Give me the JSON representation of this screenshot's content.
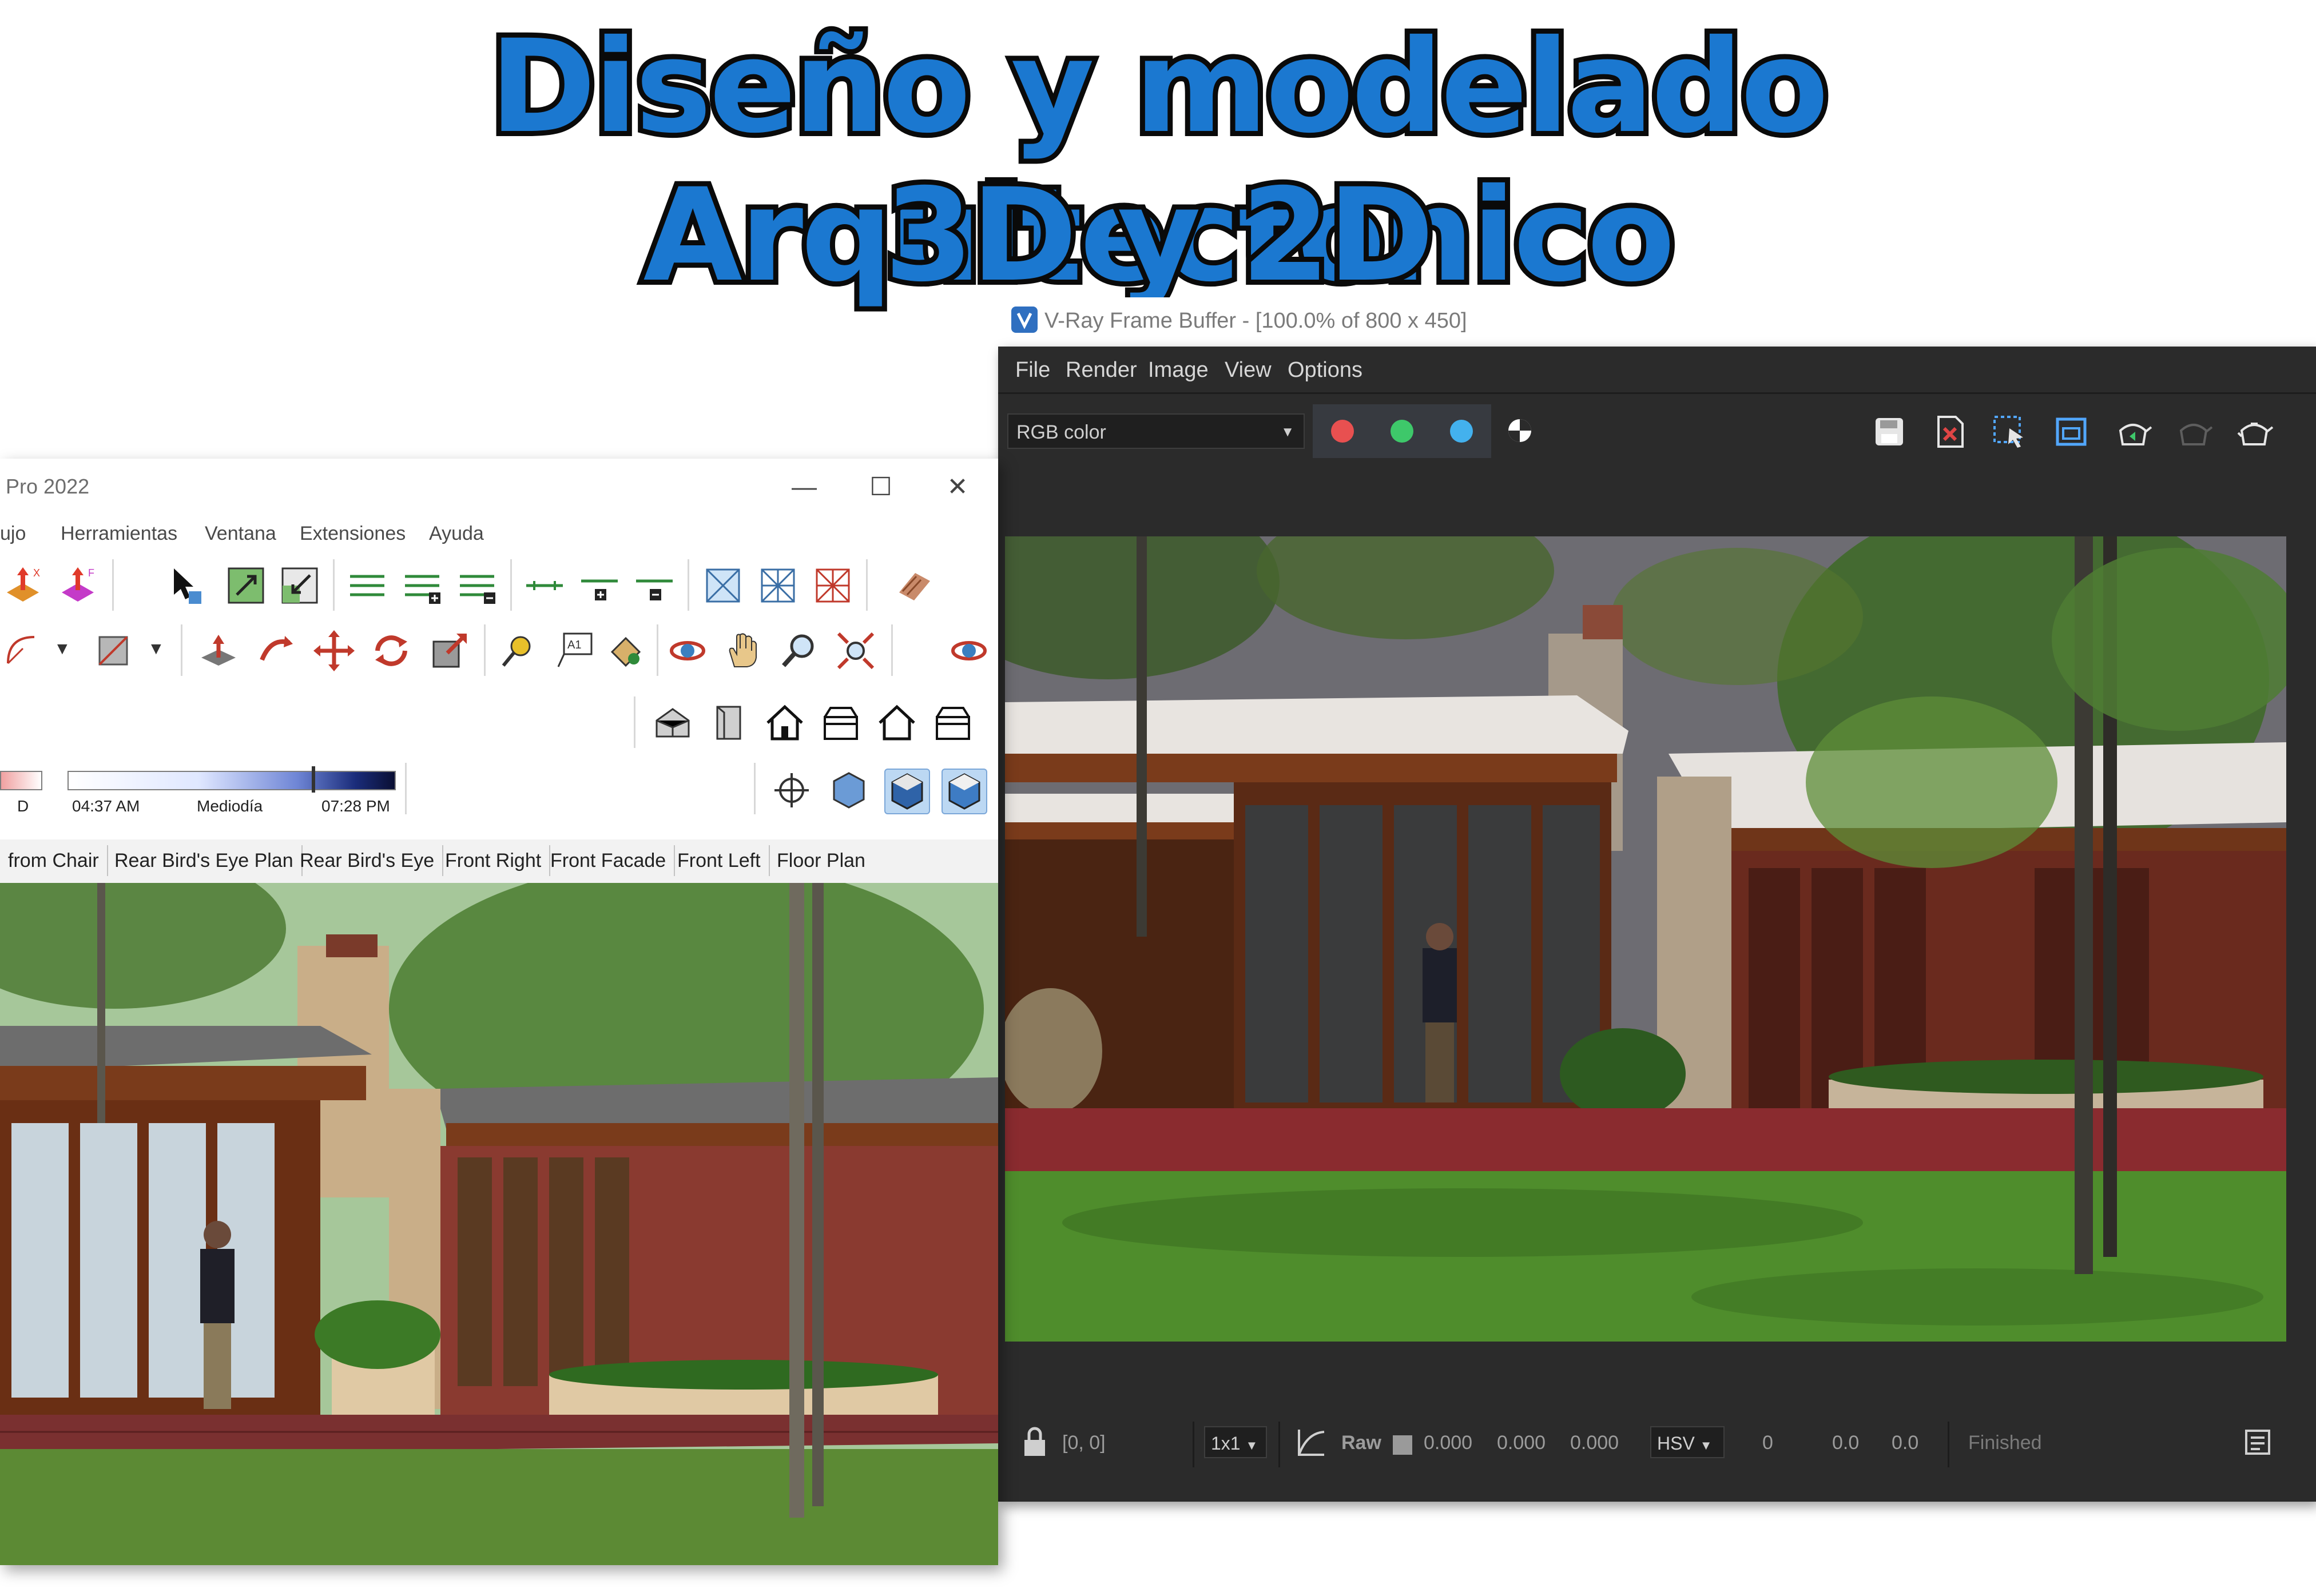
{
  "headline": {
    "line1": "Diseño y modelado Arquitectonico",
    "line2": "3D y 2D"
  },
  "sketchup": {
    "title": "Pro 2022",
    "window_controls": {
      "minimize": "—",
      "maximize": "☐",
      "close": "✕"
    },
    "menu": [
      "ujo",
      "Herramientas",
      "Ventana",
      "Extensiones",
      "Ayuda"
    ],
    "shadow": {
      "left_label": "D",
      "start_time": "04:37 AM",
      "mid_label": "Mediodía",
      "end_time": "07:28 PM"
    },
    "scenes": [
      "from Chair",
      "Rear Bird's Eye Plan",
      "Rear Bird's Eye",
      "Front Right",
      "Front Facade",
      "Front Left",
      "Floor Plan"
    ],
    "icon_text": {
      "text_tool": "A1",
      "axis_x": "X",
      "axis_f": "F"
    }
  },
  "vray": {
    "caption": "V-Ray Frame Buffer - [100.0% of 800 x 450]",
    "menu": [
      "File",
      "Render",
      "Image",
      "View",
      "Options"
    ],
    "channel_select": "RGB color",
    "channel_colors": {
      "red": "#e85050",
      "green": "#3ec86a",
      "blue": "#43b1ee"
    },
    "status": {
      "coords": "[0, 0]",
      "sampling": "1x1",
      "mode": "Raw",
      "values": [
        "0.000",
        "0.000",
        "0.000"
      ],
      "color_space": "HSV",
      "hsv_values": [
        "0",
        "0.0",
        "0.0"
      ],
      "state": "Finished"
    }
  },
  "colors": {
    "title_blue": "#1b78d0",
    "title_outline": "#0a0a0a",
    "vray_bg": "#2b2b2b",
    "lawn_green": "#4f8d2c",
    "terrace_red": "#8a2b2f",
    "wood_brown": "#7a3b1b"
  }
}
